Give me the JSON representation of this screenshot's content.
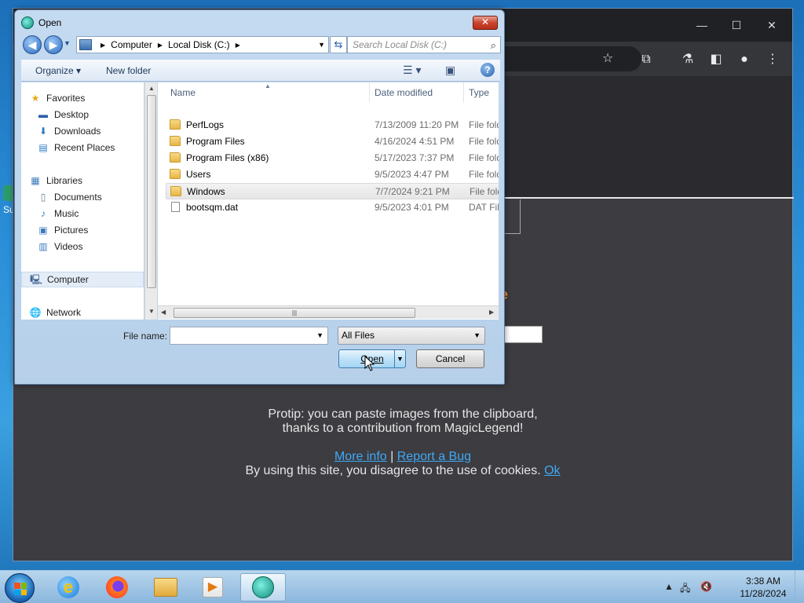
{
  "dialog": {
    "title": "Open",
    "close_label": "✕",
    "back_label": "◀",
    "forward_label": "▶",
    "breadcrumb": [
      "Computer",
      "Local Disk (C:)"
    ],
    "search_placeholder": "Search Local Disk (C:)",
    "commands": {
      "organize": "Organize",
      "new_folder": "New folder"
    },
    "nav_pane": {
      "favorites": "Favorites",
      "desktop": "Desktop",
      "downloads": "Downloads",
      "recent_places": "Recent Places",
      "libraries": "Libraries",
      "documents": "Documents",
      "music": "Music",
      "pictures": "Pictures",
      "videos": "Videos",
      "computer": "Computer",
      "network": "Network"
    },
    "columns": {
      "name": "Name",
      "date": "Date modified",
      "type": "Type"
    },
    "files": [
      {
        "name": "PerfLogs",
        "date": "7/13/2009 11:20 PM",
        "type": "File folder",
        "kind": "folder"
      },
      {
        "name": "Program Files",
        "date": "4/16/2024 4:51 PM",
        "type": "File folder",
        "kind": "folder"
      },
      {
        "name": "Program Files (x86)",
        "date": "5/17/2023 7:37 PM",
        "type": "File folder",
        "kind": "folder"
      },
      {
        "name": "Users",
        "date": "9/5/2023 4:47 PM",
        "type": "File folder",
        "kind": "folder"
      },
      {
        "name": "Windows",
        "date": "7/7/2024 9:21 PM",
        "type": "File folder",
        "kind": "folder"
      },
      {
        "name": "bootsqm.dat",
        "date": "9/5/2023 4:01 PM",
        "type": "DAT File",
        "kind": "file"
      }
    ],
    "file_name_label": "File name:",
    "file_name_value": "",
    "filter_value": "All Files",
    "open_label": "Open",
    "cancel_label": "Cancel"
  },
  "browser_page": {
    "protip_line1": "Protip: you can paste images from the clipboard,",
    "protip_line2": "thanks to a contribution from MagicLegend!",
    "more_info": "More info",
    "separator": "|",
    "report_bug": "Report a Bug",
    "cookie_text": "By using this site, you disagree to the use of cookies.",
    "ok_link": "Ok",
    "orange_fragment": "e"
  },
  "taskbar": {
    "time": "3:38 AM",
    "date": "11/28/2024",
    "apps": [
      "internet-explorer",
      "firefox",
      "file-explorer",
      "media-player",
      "app-active"
    ]
  },
  "colors": {
    "link": "#3fa9f5",
    "page_bg": "#3c3c41",
    "accent_orange": "#ff8c1a"
  }
}
